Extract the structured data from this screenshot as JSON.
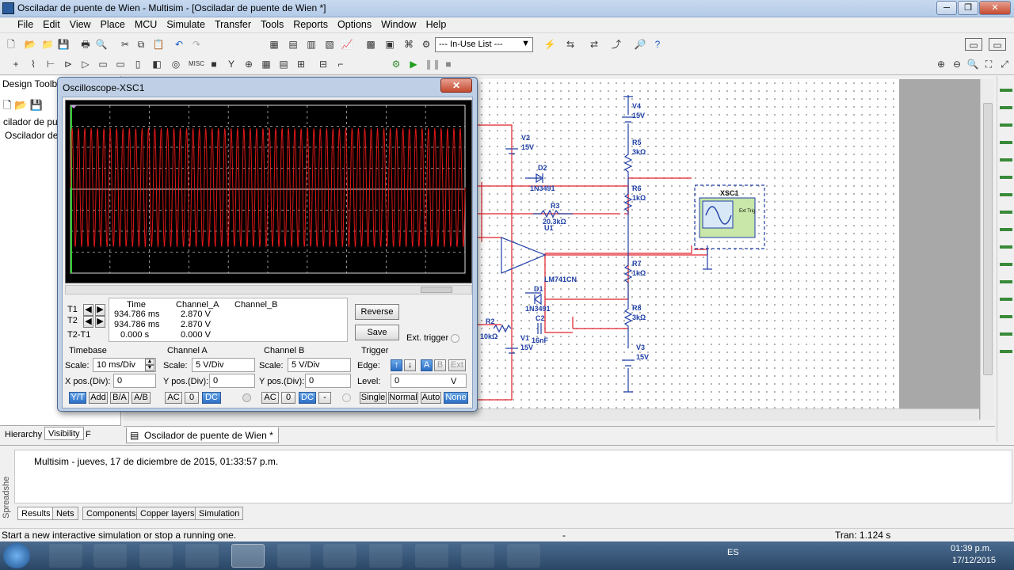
{
  "window": {
    "title": "Osciladar de puente de Wien - Multisim - [Osciladar de puente de Wien *]"
  },
  "menu": [
    "File",
    "Edit",
    "View",
    "Place",
    "MCU",
    "Simulate",
    "Transfer",
    "Tools",
    "Reports",
    "Options",
    "Window",
    "Help"
  ],
  "toolbar": {
    "inuse_list": "--- In-Use List ---"
  },
  "design_toolbox": {
    "header": "Design Toolb",
    "item1": "cilador de pue",
    "item2": "Oscilador de",
    "tab_hierarchy": "Hierarchy",
    "tab_visibility": "Visibility",
    "tab_p": "F"
  },
  "document_tab": "Oscilador de puente de Wien *",
  "scope": {
    "title": "Oscilloscope-XSC1",
    "readout": {
      "headers": [
        "Time",
        "Channel_A",
        "Channel_B"
      ],
      "row_labels": [
        "T1",
        "T2",
        "T2-T1"
      ],
      "t1": {
        "time": "934.786 ms",
        "a": "2.870 V",
        "b": ""
      },
      "t2": {
        "time": "934.786 ms",
        "a": "2.870 V",
        "b": ""
      },
      "dt": {
        "time": "0.000 s",
        "a": "0.000 V",
        "b": ""
      }
    },
    "buttons": {
      "reverse": "Reverse",
      "save": "Save",
      "ext_trigger": "Ext. trigger"
    },
    "timebase": {
      "title": "Timebase",
      "scale_label": "Scale:",
      "scale": "10 ms/Div",
      "xpos_label": "X pos.(Div):",
      "xpos": "0",
      "modes": [
        "Y/T",
        "Add",
        "B/A",
        "A/B"
      ]
    },
    "channel_a": {
      "title": "Channel A",
      "scale_label": "Scale:",
      "scale": "5  V/Div",
      "ypos_label": "Y pos.(Div):",
      "ypos": "0",
      "coupling": [
        "AC",
        "0",
        "DC"
      ]
    },
    "channel_b": {
      "title": "Channel B",
      "scale_label": "Scale:",
      "scale": "5  V/Div",
      "ypos_label": "Y pos.(Div):",
      "ypos": "0",
      "coupling": [
        "AC",
        "0",
        "DC",
        "-"
      ]
    },
    "trigger": {
      "title": "Trigger",
      "edge_label": "Edge:",
      "edge_sources": [
        "A",
        "B",
        "Ext"
      ],
      "level_label": "Level:",
      "level": "0",
      "level_unit": "V",
      "modes": [
        "Single",
        "Normal",
        "Auto",
        "None"
      ]
    },
    "trace_color": "#e01818"
  },
  "schematic": {
    "components": [
      {
        "ref": "V4",
        "val": "15V"
      },
      {
        "ref": "R5",
        "val": "3kΩ"
      },
      {
        "ref": "R6",
        "val": "1kΩ"
      },
      {
        "ref": "R7",
        "val": "1kΩ"
      },
      {
        "ref": "R8",
        "val": "3kΩ"
      },
      {
        "ref": "V3",
        "val": "15V"
      },
      {
        "ref": "V2",
        "val": "15V"
      },
      {
        "ref": "D2",
        "val": "1N3491"
      },
      {
        "ref": "R3",
        "val": "20.3kΩ"
      },
      {
        "ref": "U1",
        "val": "LM741CN"
      },
      {
        "ref": "D1",
        "val": "1N3491"
      },
      {
        "ref": "R2",
        "val": "10kΩ"
      },
      {
        "ref": "C2",
        "val": "16nF"
      },
      {
        "ref": "V1",
        "val": "15V"
      }
    ],
    "instrument": {
      "ref": "XSC1",
      "ext_trig": "Ext Trig"
    }
  },
  "spreadsheet": {
    "side_label": "Spreadshe",
    "message": "Multisim  -  jueves, 17 de diciembre de 2015, 01:33:57 p.m.",
    "tabs": [
      "Results",
      "Nets",
      "Components",
      "Copper layers",
      "Simulation"
    ]
  },
  "status": {
    "left": "Start a new interactive simulation or stop a running one.",
    "mid": "-",
    "right": "Tran: 1.124 s"
  },
  "taskbar": {
    "lang": "ES",
    "time": "01:39 p.m.",
    "date": "17/12/2015"
  }
}
